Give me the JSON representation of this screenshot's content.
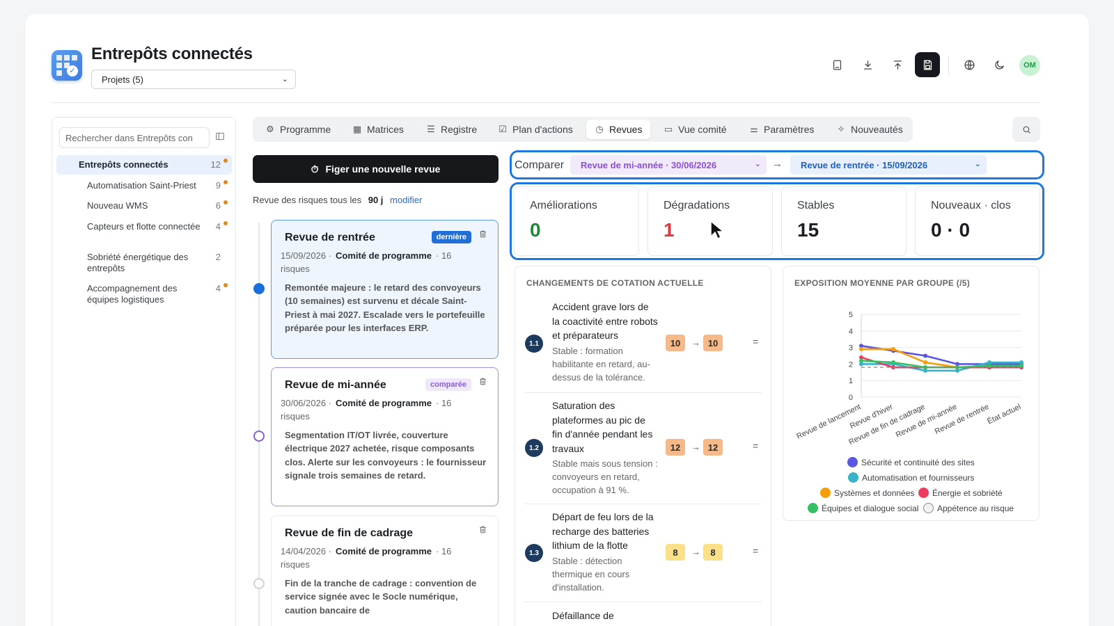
{
  "header": {
    "title": "Entrepôts connectés",
    "project_select": "Projets (5)",
    "avatar_initials": "OM"
  },
  "sidebar": {
    "search_placeholder": "Rechercher dans Entrepôts con",
    "root": {
      "label": "Entrepôts connectés",
      "count": "12"
    },
    "items": [
      {
        "label": "Automatisation Saint-Priest",
        "count": "9",
        "dot": true
      },
      {
        "label": "Nouveau WMS",
        "count": "6",
        "dot": true
      },
      {
        "label": "Capteurs et flotte connectée",
        "count": "4",
        "dot": true
      },
      {
        "label": "Sobriété énergétique des entrepôts",
        "count": "2",
        "dot": false
      },
      {
        "label": "Accompagnement des équipes logistiques",
        "count": "4",
        "dot": true
      }
    ]
  },
  "tabs": [
    {
      "label": "Programme",
      "icon": "⚙"
    },
    {
      "label": "Matrices",
      "icon": "▦"
    },
    {
      "label": "Registre",
      "icon": "☰"
    },
    {
      "label": "Plan d'actions",
      "icon": "☑"
    },
    {
      "label": "Revues",
      "icon": "◷"
    },
    {
      "label": "Vue comité",
      "icon": "▭"
    },
    {
      "label": "Paramètres",
      "icon": "⚌"
    },
    {
      "label": "Nouveautés",
      "icon": "✧"
    }
  ],
  "reviews_panel": {
    "freeze_button": "Figer une nouvelle revue",
    "frequency_text": "Revue des risques tous les",
    "frequency_value": "90 j",
    "frequency_link": "modifier",
    "reviews": [
      {
        "title": "Revue de rentrée",
        "badge": "dernière",
        "date": "15/09/2026 ·",
        "org": "Comité de programme",
        "risks": "· 16 risques",
        "note": "Remontée majeure : le retard des convoyeurs (10 semaines) est survenu et décale Saint-Priest à mai 2027. Escalade vers le portefeuille préparée pour les interfaces ERP."
      },
      {
        "title": "Revue de mi-année",
        "badge": "comparée",
        "date": "30/06/2026 ·",
        "org": "Comité de programme",
        "risks": "· 16 risques",
        "note": "Segmentation IT/OT livrée, couverture électrique 2027 achetée, risque composants clos. Alerte sur les convoyeurs : le fournisseur signale trois semaines de retard."
      },
      {
        "title": "Revue de fin de cadrage",
        "badge": "",
        "date": "14/04/2026 ·",
        "org": "Comité de programme",
        "risks": "· 16 risques",
        "note": "Fin de la tranche de cadrage : convention de service signée avec le Socle numérique, caution bancaire de"
      }
    ]
  },
  "compare": {
    "label": "Comparer",
    "from": "Revue de mi-année · 30/06/2026",
    "to": "Revue de rentrée · 15/09/2026"
  },
  "stats": [
    {
      "label": "Améliorations",
      "value": "0",
      "color": "#1f8a3c"
    },
    {
      "label": "Dégradations",
      "value": "1",
      "color": "#e0383e"
    },
    {
      "label": "Stables",
      "value": "15",
      "color": "#1b1f24"
    },
    {
      "label": "Nouveaux · clos",
      "value": "0 · 0",
      "color": "#1b1f24"
    }
  ],
  "changes": {
    "heading": "CHANGEMENTS DE COTATION ACTUELLE",
    "items": [
      {
        "num": "1.1",
        "title": "Accident grave lors de la coactivité entre robots et préparateurs",
        "status": "Stable : formation habilitante en retard, au-dessus de la tolérance.",
        "from": "10",
        "to": "10",
        "sign": "=",
        "tone": "orange"
      },
      {
        "num": "1.2",
        "title": "Saturation des plateformes au pic de fin d'année pendant les travaux",
        "status": "Stable mais sous tension : convoyeurs en retard, occupation à 91 %.",
        "from": "12",
        "to": "12",
        "sign": "=",
        "tone": "orange"
      },
      {
        "num": "1.3",
        "title": "Départ de feu lors de la recharge des batteries lithium de la flotte",
        "status": "Stable : détection thermique en cours d'installation.",
        "from": "8",
        "to": "8",
        "sign": "=",
        "tone": "yellow"
      },
      {
        "num": "",
        "title": "Défaillance de",
        "status": "",
        "from": "",
        "to": "",
        "sign": "",
        "tone": ""
      }
    ]
  },
  "chart_data": {
    "type": "line",
    "title": "EXPOSITION MOYENNE PAR GROUPE (/5)",
    "categories": [
      "Revue de lancement",
      "Revue d'hiver",
      "Revue de fin de cadrage",
      "Revue de mi-année",
      "Revue de rentrée",
      "État actuel"
    ],
    "ylim": [
      0,
      5
    ],
    "yticks": [
      0,
      1,
      2,
      3,
      4,
      5
    ],
    "grid": true,
    "legend_position": "bottom",
    "series": [
      {
        "name": "Sécurité et continuité des sites",
        "color": "#5b55e0",
        "values": [
          3.1,
          2.8,
          2.5,
          2.0,
          2.0,
          2.0
        ]
      },
      {
        "name": "Automatisation et fournisseurs",
        "color": "#36b3c9",
        "values": [
          2.0,
          2.0,
          1.6,
          1.6,
          2.1,
          2.1
        ]
      },
      {
        "name": "Systèmes et données",
        "color": "#f59e0b",
        "values": [
          2.9,
          2.9,
          2.1,
          1.8,
          1.8,
          1.8
        ]
      },
      {
        "name": "Énergie et sobriété",
        "color": "#ef3b5d",
        "values": [
          2.4,
          1.8,
          1.8,
          1.8,
          1.8,
          1.8
        ]
      },
      {
        "name": "Équipes et dialogue social",
        "color": "#34c163",
        "values": [
          2.2,
          2.1,
          1.8,
          1.8,
          1.9,
          1.9
        ]
      },
      {
        "name": "Appétence au risque",
        "color": "#888888",
        "values": [
          1.8,
          1.8,
          1.8,
          1.8,
          1.8,
          1.8
        ],
        "dashed": true
      }
    ]
  }
}
